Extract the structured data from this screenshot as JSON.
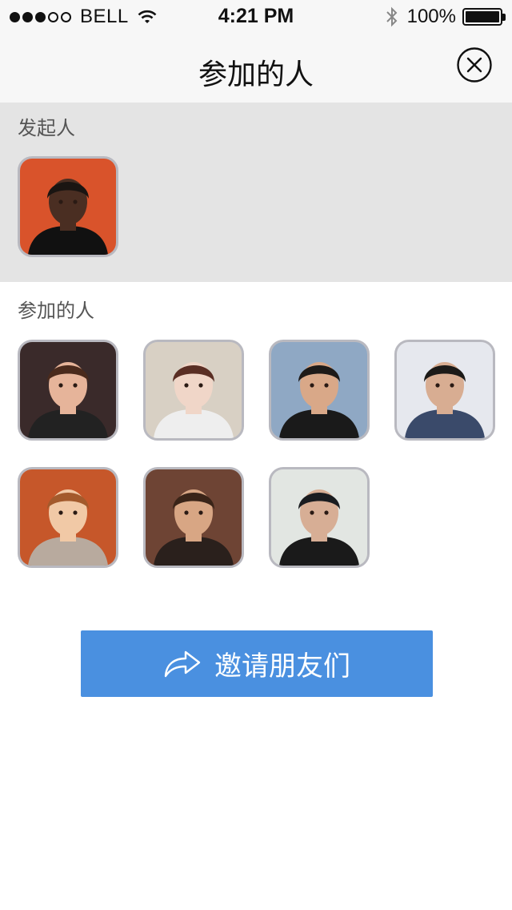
{
  "status_bar": {
    "carrier": "BELL",
    "time": "4:21 PM",
    "battery": "100%"
  },
  "nav": {
    "title": "参加的人",
    "close_icon": "close-circle-icon"
  },
  "initiator_section": {
    "label": "发起人",
    "avatars": [
      {
        "name": "initiator-avatar",
        "bg": "#d9532b",
        "skin": "#4a2e22",
        "hair": "#1a1512",
        "shirt": "#111111"
      }
    ]
  },
  "participants_section": {
    "label": "参加的人",
    "avatars": [
      {
        "bg": "#3a2a2a",
        "skin": "#e6b49a",
        "hair": "#4a2a1c",
        "shirt": "#222222"
      },
      {
        "bg": "#d8d0c4",
        "skin": "#f0d6c8",
        "hair": "#5a2e24",
        "shirt": "#eeeeee"
      },
      {
        "bg": "#8fa8c4",
        "skin": "#d9a888",
        "hair": "#1e1a18",
        "shirt": "#1a1a1a"
      },
      {
        "bg": "#e6e8ee",
        "skin": "#d8ad92",
        "hair": "#1c1a18",
        "shirt": "#3a4a6a"
      },
      {
        "bg": "#c6572a",
        "skin": "#f1c9a6",
        "hair": "#a35a2c",
        "shirt": "#b8aa9e"
      },
      {
        "bg": "#6e4434",
        "skin": "#d8a684",
        "hair": "#3a2418",
        "shirt": "#2a201c"
      },
      {
        "bg": "#e2e6e2",
        "skin": "#d7ae95",
        "hair": "#1a1c20",
        "shirt": "#1a1a1a"
      }
    ]
  },
  "invite_button": {
    "label": "邀请朋友们",
    "icon": "share-arrow-icon",
    "color": "#4a90e0"
  }
}
